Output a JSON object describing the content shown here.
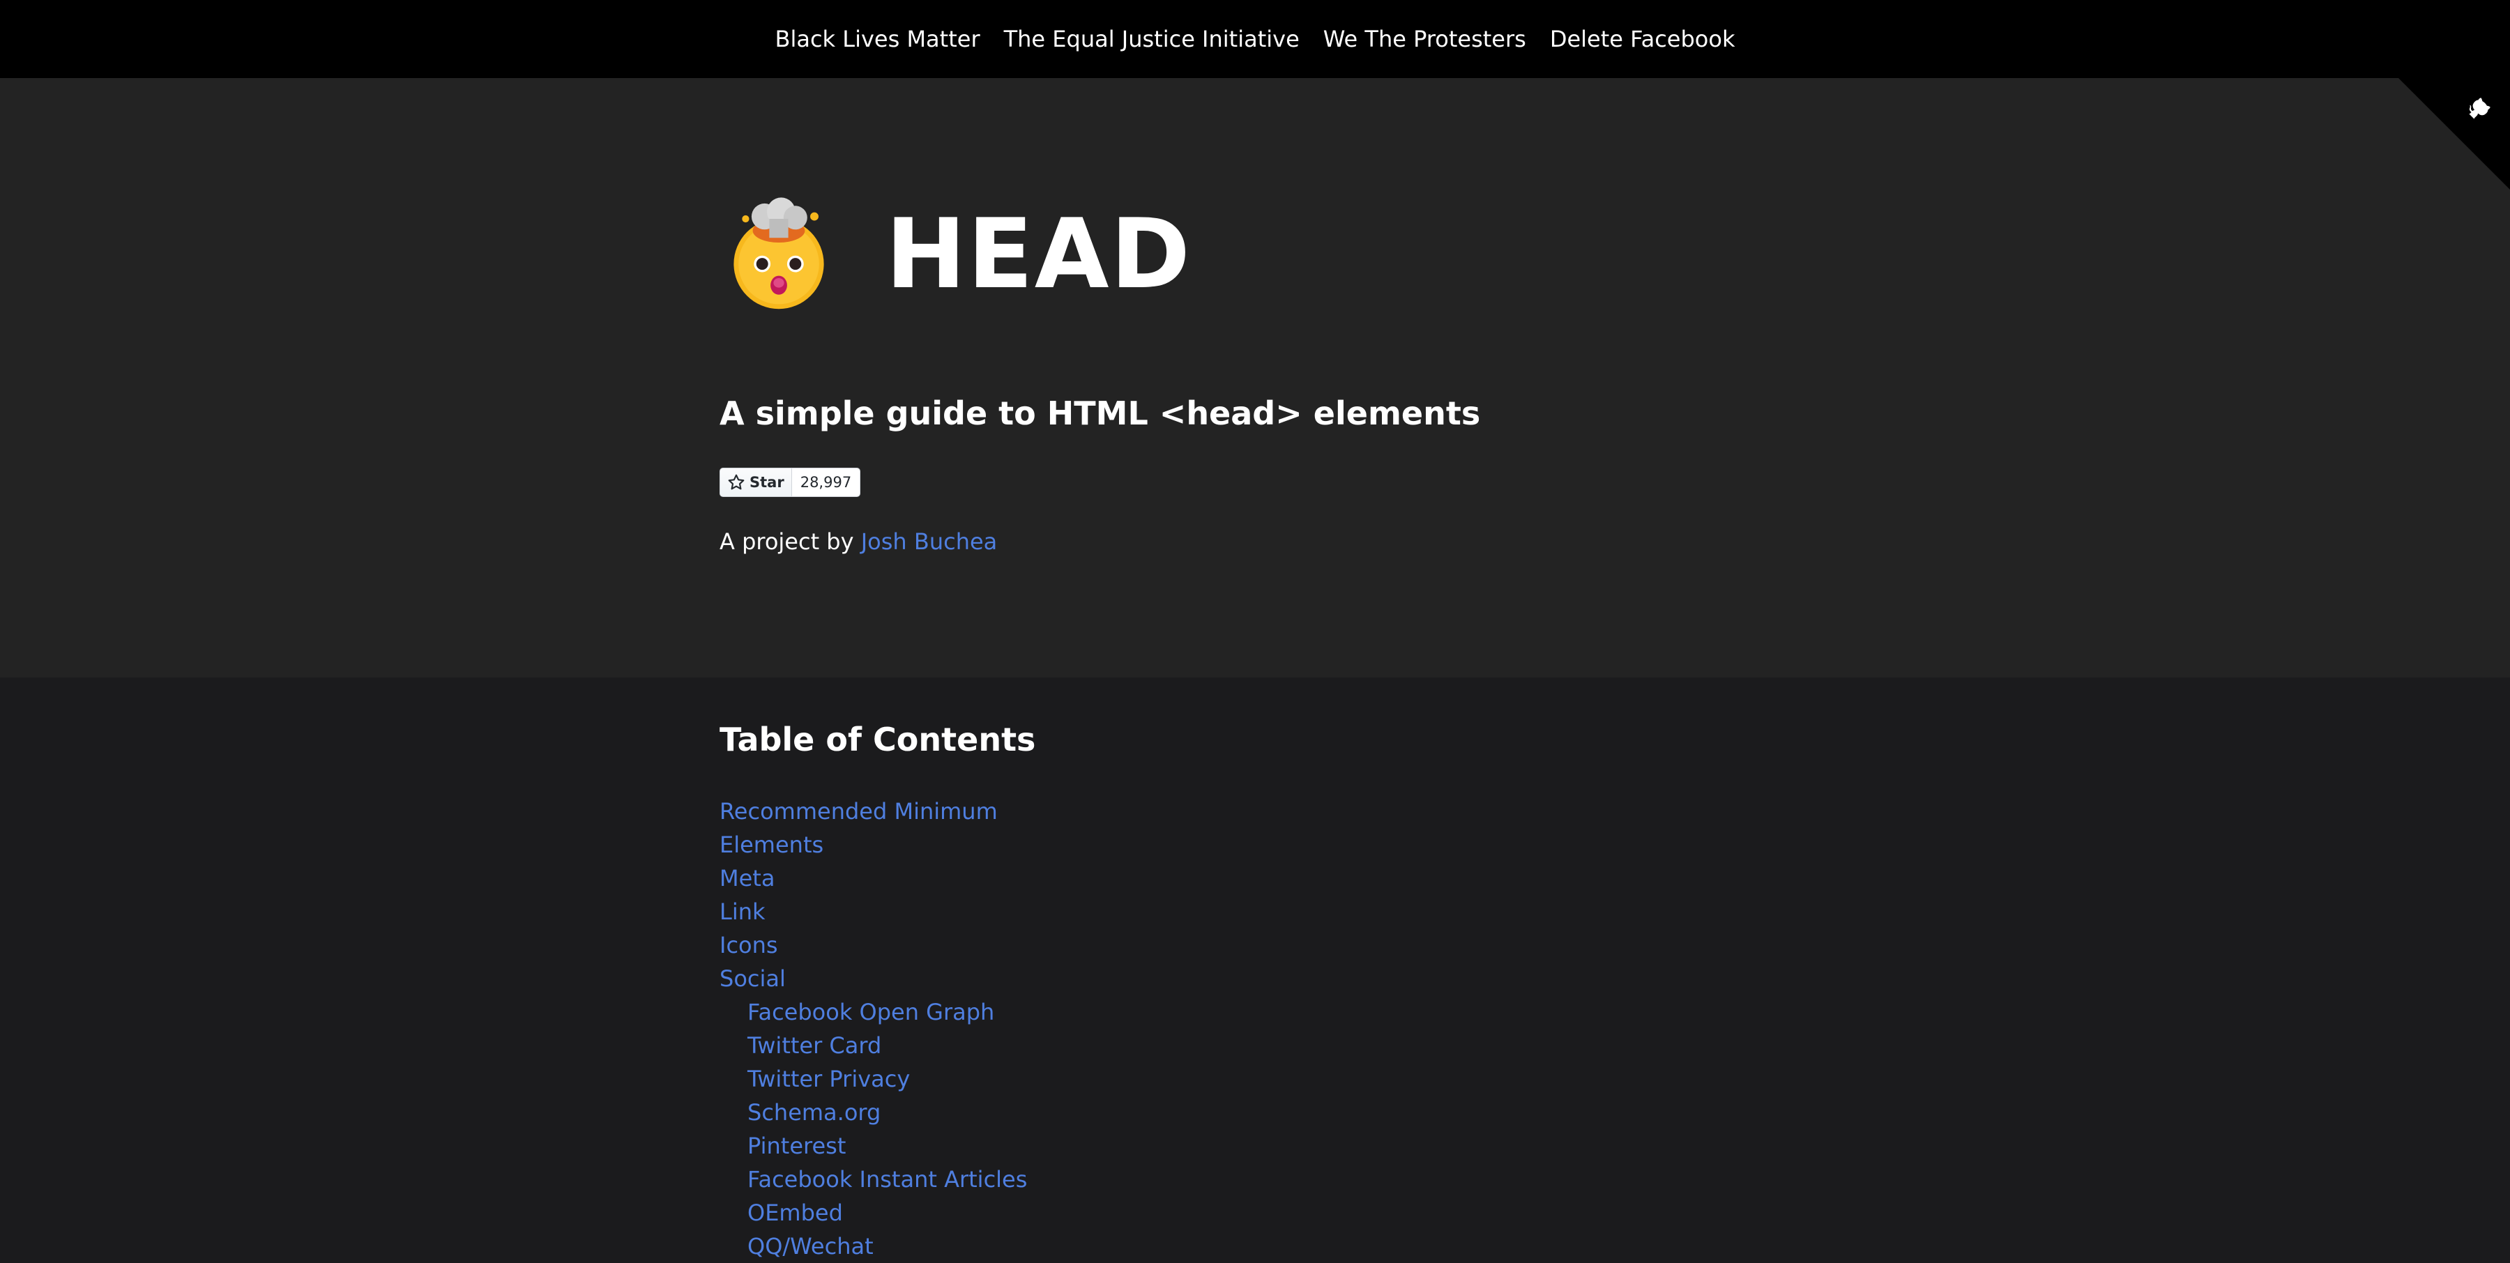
{
  "nav": {
    "links": [
      "Black Lives Matter",
      "The Equal Justice Initiative",
      "We The Protesters",
      "Delete Facebook"
    ]
  },
  "corner": {
    "icon": "github-octocat-icon"
  },
  "hero": {
    "logo_icon": "exploding-head-emoji-icon",
    "title": "HEAD",
    "subtitle": "A simple guide to HTML <head> elements",
    "star_label": "Star",
    "star_count": "28,997",
    "byline_prefix": "A project by ",
    "author": "Josh Buchea"
  },
  "toc": {
    "title": "Table of Contents",
    "items": [
      "Recommended Minimum",
      "Elements",
      "Meta",
      "Link",
      "Icons",
      "Social"
    ],
    "subitems": [
      "Facebook Open Graph",
      "Twitter Card",
      "Twitter Privacy",
      "Schema.org",
      "Pinterest",
      "Facebook Instant Articles",
      "OEmbed",
      "QQ/Wechat"
    ]
  },
  "colors": {
    "nav_bg": "#000000",
    "hero_bg": "#232323",
    "page_bg": "#1b1b1d",
    "link": "#4f7fe0",
    "text": "#ffffff"
  }
}
